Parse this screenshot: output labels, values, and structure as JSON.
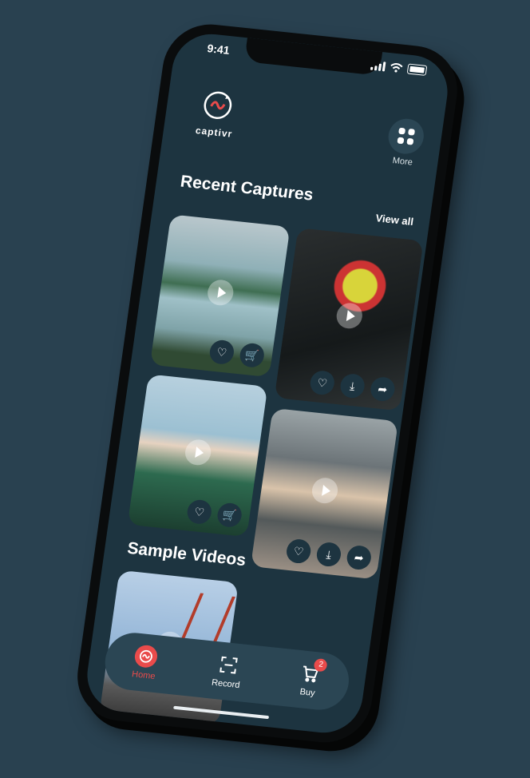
{
  "status_bar": {
    "time": "9:41"
  },
  "brand": {
    "name": "captivr"
  },
  "header": {
    "more_label": "More"
  },
  "recent": {
    "title": "Recent Captures",
    "view_all": "View all"
  },
  "sample": {
    "title": "Sample Videos"
  },
  "tabs": [
    {
      "label": "Home",
      "icon": "home-logo-icon",
      "active": true
    },
    {
      "label": "Record",
      "icon": "record-frame-icon",
      "active": false
    },
    {
      "label": "Buy",
      "icon": "cart-icon",
      "active": false,
      "badge": "2"
    }
  ],
  "colors": {
    "accent": "#e94b4b",
    "background": "#294150",
    "screen": "#1d3440"
  }
}
